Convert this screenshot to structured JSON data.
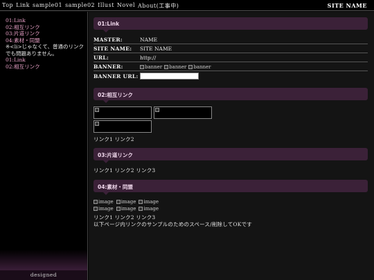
{
  "topnav": {
    "items": [
      "Top",
      "Link",
      "sample01",
      "sample02",
      "Illust",
      "Novel",
      "About(工事中)"
    ],
    "site_name": "SITE NAME"
  },
  "sidebar": {
    "links": [
      "01:Link",
      "02:相互リンク",
      "03:片道リンク",
      "04:素材・同盟"
    ],
    "note": "※<li>じゃなくて、普通のリンクでも問題ありません。",
    "extra_links": [
      "01:Link",
      "02:相互リンク"
    ],
    "footer": "designed"
  },
  "sections": {
    "s1": {
      "title": "01:Link",
      "rows": [
        {
          "key": "MASTER:",
          "value": "NAME"
        },
        {
          "key": "SITE NAME:",
          "value": "SITE NAME"
        },
        {
          "key": "URL:",
          "value": "http://"
        },
        {
          "key": "BANNER:",
          "banners": [
            "banner",
            "banner",
            "banner"
          ]
        },
        {
          "key": "BANNER URL:",
          "input_value": ""
        }
      ]
    },
    "s2": {
      "title": "02:相互リンク",
      "links": "リンク1 リンク2"
    },
    "s3": {
      "title": "03:片道リンク",
      "links": "リンク1 リンク2 リンク3"
    },
    "s4": {
      "title": "04:素材・同盟",
      "images_row1": [
        "image",
        "image",
        "image"
      ],
      "images_row2": [
        "image",
        "image",
        "image"
      ],
      "links": "リンク1 リンク2 リンク3",
      "note": "以下ページ内リンクのサンプルのためのスペース/削除してOKです"
    }
  }
}
